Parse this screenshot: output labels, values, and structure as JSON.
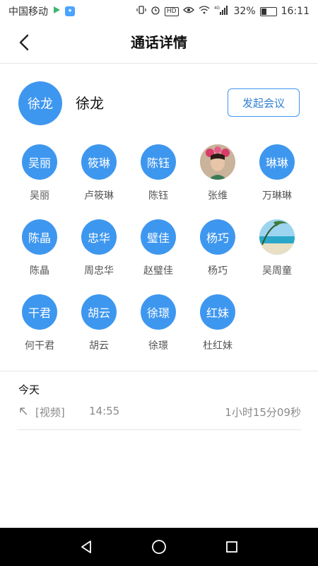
{
  "status_bar": {
    "carrier": "中国移动",
    "network": "4G",
    "battery": "32%",
    "battery_level": 0.32,
    "time": "16:11",
    "hd_badge": "HD"
  },
  "header": {
    "title": "通话详情"
  },
  "contact": {
    "avatar_text": "徐龙",
    "name": "徐龙",
    "meeting_button": "发起会议"
  },
  "members": [
    {
      "avatar": "吴丽",
      "name": "吴丽"
    },
    {
      "avatar": "筱琳",
      "name": "卢筱琳"
    },
    {
      "avatar": "陈钰",
      "name": "陈钰"
    },
    {
      "avatar": "",
      "name": "张维",
      "photo": "portrait"
    },
    {
      "avatar": "琳琳",
      "name": "万琳琳"
    },
    {
      "avatar": "陈晶",
      "name": "陈晶"
    },
    {
      "avatar": "忠华",
      "name": "周忠华"
    },
    {
      "avatar": "璧佳",
      "name": "赵璧佳"
    },
    {
      "avatar": "杨巧",
      "name": "杨巧"
    },
    {
      "avatar": "",
      "name": "吴周童",
      "photo": "beach"
    },
    {
      "avatar": "干君",
      "name": "何干君"
    },
    {
      "avatar": "胡云",
      "name": "胡云"
    },
    {
      "avatar": "徐璟",
      "name": "徐璟"
    },
    {
      "avatar": "红妹",
      "name": "杜红妹"
    }
  ],
  "history": {
    "day_label": "今天",
    "records": [
      {
        "type": "[视频]",
        "time": "14:55",
        "duration": "1小时15分09秒"
      }
    ]
  },
  "colors": {
    "accent": "#3e97ef",
    "accent_text": "#2f7fd0"
  }
}
